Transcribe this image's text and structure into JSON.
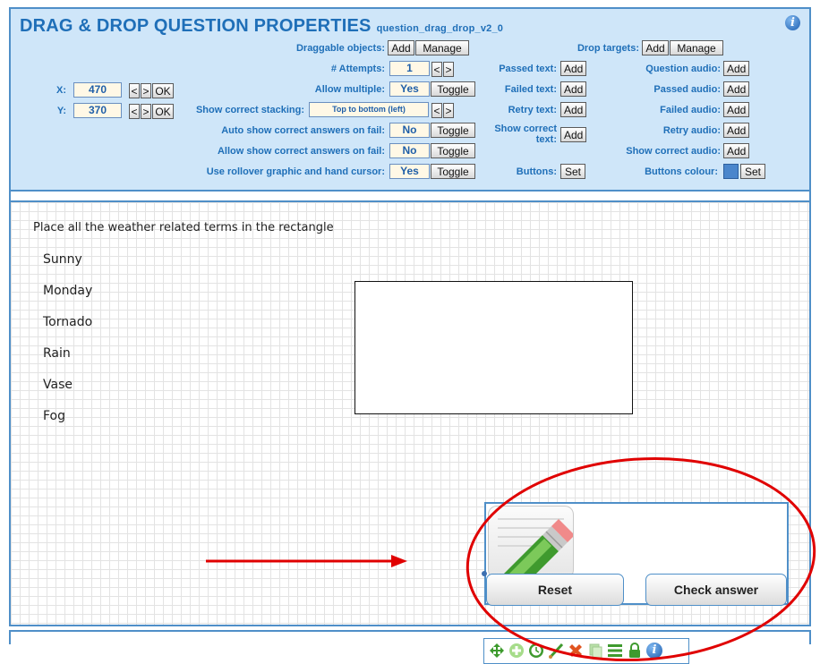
{
  "panel": {
    "title": "DRAG & DROP QUESTION PROPERTIES",
    "subtitle": "question_drag_drop_v2_0",
    "info_icon": "info-icon"
  },
  "position": {
    "x_label": "X:",
    "x_value": "470",
    "y_label": "Y:",
    "y_value": "370",
    "prev": "<",
    "next": ">",
    "ok": "OK"
  },
  "props": {
    "draggable_label": "Draggable objects:",
    "add": "Add",
    "manage": "Manage",
    "attempts_label": "# Attempts:",
    "attempts_value": "1",
    "prev": "<",
    "next": ">",
    "allow_multiple_label": "Allow multiple:",
    "allow_multiple_value": "Yes",
    "toggle": "Toggle",
    "stacking_label": "Show correct stacking:",
    "stacking_value": "Top to bottom (left)",
    "auto_show_label": "Auto show correct answers on fail:",
    "auto_show_value": "No",
    "allow_show_label": "Allow show correct answers on fail:",
    "allow_show_value": "No",
    "rollover_label": "Use rollover graphic and hand cursor:",
    "rollover_value": "Yes"
  },
  "texts": {
    "passed_label": "Passed text:",
    "failed_label": "Failed text:",
    "retry_label": "Retry text:",
    "show_correct_label_1": "Show correct",
    "show_correct_label_2": "text:",
    "buttons_label": "Buttons:",
    "add": "Add",
    "set": "Set"
  },
  "audio": {
    "drop_targets_label": "Drop targets:",
    "add": "Add",
    "manage": "Manage",
    "question_label": "Question audio:",
    "passed_label": "Passed audio:",
    "failed_label": "Failed audio:",
    "retry_label": "Retry audio:",
    "show_correct_label": "Show correct audio:",
    "buttons_colour_label": "Buttons colour:",
    "buttons_colour": "#4a86cc",
    "set": "Set"
  },
  "question": {
    "instruction": "Place all the weather related terms in the rectangle",
    "terms": [
      "Sunny",
      "Monday",
      "Tornado",
      "Rain",
      "Vase",
      "Fog"
    ]
  },
  "widget": {
    "icon": "pencil-notepad-icon",
    "reset": "Reset",
    "check": "Check answer"
  },
  "toolbar": {
    "icons": [
      "move-icon",
      "add-icon",
      "clock-icon",
      "brush-icon",
      "delete-icon",
      "copy-icon",
      "list-icon",
      "lock-icon",
      "info-icon"
    ]
  },
  "annotation": {
    "color": "#e00000",
    "shapes": [
      "arrow",
      "ellipse"
    ]
  }
}
